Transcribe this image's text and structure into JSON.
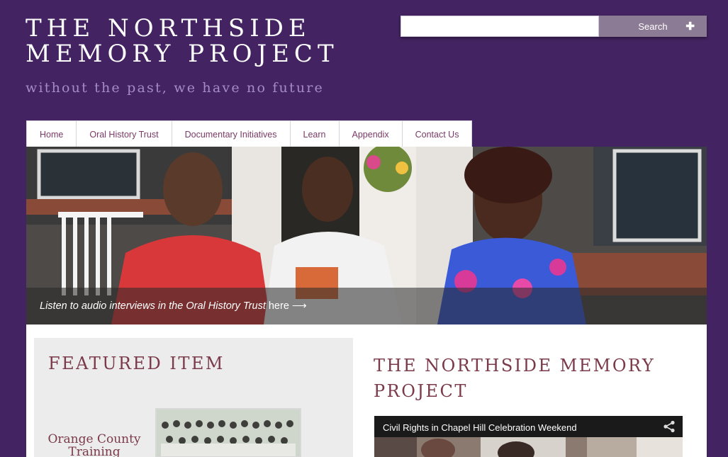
{
  "header": {
    "title_line1": "THE NORTHSIDE",
    "title_line2": "MEMORY PROJECT",
    "tagline": "without the past, we have no future"
  },
  "search": {
    "value": "",
    "button_label": "Search",
    "advanced_icon": "plus-icon"
  },
  "nav": {
    "items": [
      {
        "label": "Home"
      },
      {
        "label": "Oral History Trust"
      },
      {
        "label": "Documentary Initiatives"
      },
      {
        "label": "Learn"
      },
      {
        "label": "Appendix"
      },
      {
        "label": "Contact Us"
      }
    ]
  },
  "hero": {
    "caption": "Listen to audio interviews in the Oral History Trust",
    "link_label": "here",
    "arrow": "⟶"
  },
  "featured": {
    "heading": "FEATURED ITEM",
    "item_title": "Orange County Training School"
  },
  "main": {
    "heading": "THE NORTHSIDE MEMORY PROJECT",
    "video_title": "Civil Rights in Chapel Hill Celebration Weekend",
    "share_icon": "share-icon"
  },
  "colors": {
    "background": "#432361",
    "heading": "#7a3a4a",
    "nav_text": "#7a3a66",
    "tagline": "#a58ac9",
    "search_button": "#8c7b94"
  }
}
